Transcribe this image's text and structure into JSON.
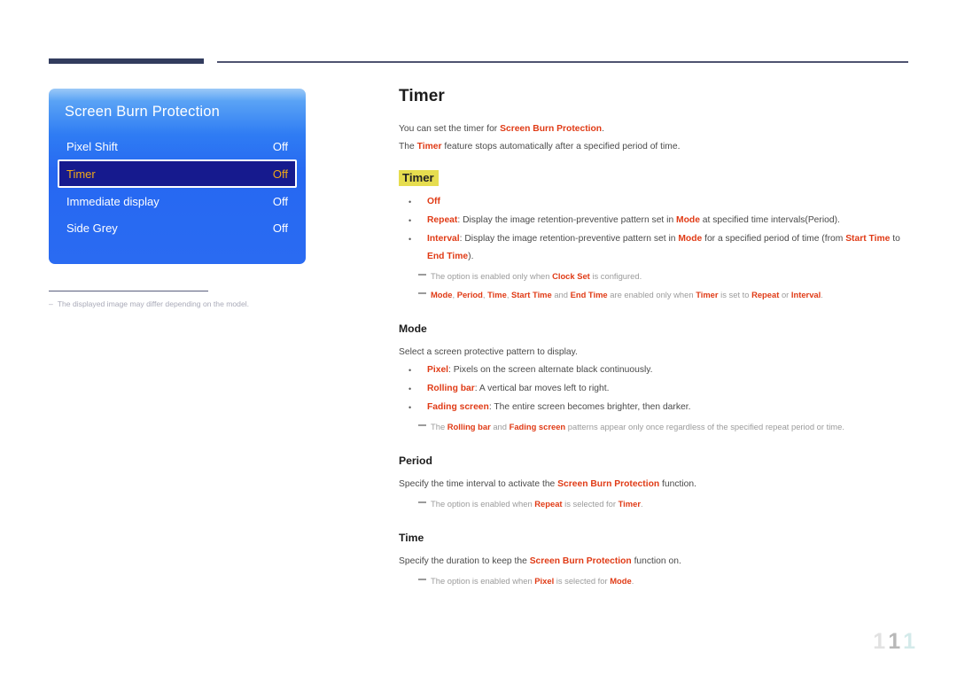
{
  "colors": {
    "accent": "#e03b16",
    "highlight": "#e6dd4f",
    "osd_blue": "#2a6bf2",
    "osd_selected": "#161a8e",
    "osd_selected_text": "#f0a818",
    "rule_navy": "#323c5e"
  },
  "osd": {
    "title": "Screen Burn Protection",
    "rows": [
      {
        "label": "Pixel Shift",
        "value": "Off",
        "selected": false
      },
      {
        "label": "Timer",
        "value": "Off",
        "selected": true
      },
      {
        "label": "Immediate display",
        "value": "Off",
        "selected": false
      },
      {
        "label": "Side Grey",
        "value": "Off",
        "selected": false
      }
    ],
    "caption_dash": "–",
    "caption": "The displayed image may differ depending on the model."
  },
  "content": {
    "page_title": "Timer",
    "intro_1_prefix": "You can set the timer for ",
    "intro_1_accent": "Screen Burn Protection",
    "intro_1_suffix": ".",
    "intro_2_prefix": "The ",
    "intro_2_accent": "Timer",
    "intro_2_suffix": " feature stops automatically after a specified period of time.",
    "timer_section": {
      "heading": "Timer",
      "bullets": [
        {
          "term": "Off",
          "rest": ""
        },
        {
          "term": "Repeat",
          "rest": ": Display the image retention-preventive pattern set in Mode at specified time intervals(Period)."
        },
        {
          "term": "Interval",
          "rest": ": Display the image retention-preventive pattern set in Mode for a specified period of time (from Start Time to End Time)."
        }
      ],
      "notes": [
        "The option is enabled only when Clock Set is configured.",
        "Mode, Period, Time, Start Time and End Time are enabled only when Timer is set to Repeat or Interval."
      ]
    },
    "mode_section": {
      "heading": "Mode",
      "intro": "Select a screen protective pattern to display.",
      "bullets": [
        {
          "term": "Pixel",
          "rest": ": Pixels on the screen alternate black continuously."
        },
        {
          "term": "Rolling bar",
          "rest": ": A vertical bar moves left to right."
        },
        {
          "term": "Fading screen",
          "rest": ": The entire screen becomes brighter, then darker."
        }
      ],
      "notes": [
        "The Rolling bar and Fading screen patterns appear only once regardless of the specified repeat period or time."
      ]
    },
    "period_section": {
      "heading": "Period",
      "intro_prefix": "Specify the time interval to activate the ",
      "intro_accent": "Screen Burn Protection",
      "intro_suffix": " function.",
      "note_parts": [
        "The option is enabled when ",
        "Repeat",
        " is selected for ",
        "Timer",
        "."
      ]
    },
    "time_section": {
      "heading": "Time",
      "intro_prefix": "Specify the duration to keep the ",
      "intro_accent": "Screen Burn Protection",
      "intro_suffix": " function on.",
      "note_parts": [
        "The option is enabled when ",
        "Pixel",
        " is selected for ",
        "Mode",
        "."
      ]
    }
  },
  "footer": {
    "page_number": "111",
    "digits": [
      "1",
      "1",
      "1"
    ]
  }
}
